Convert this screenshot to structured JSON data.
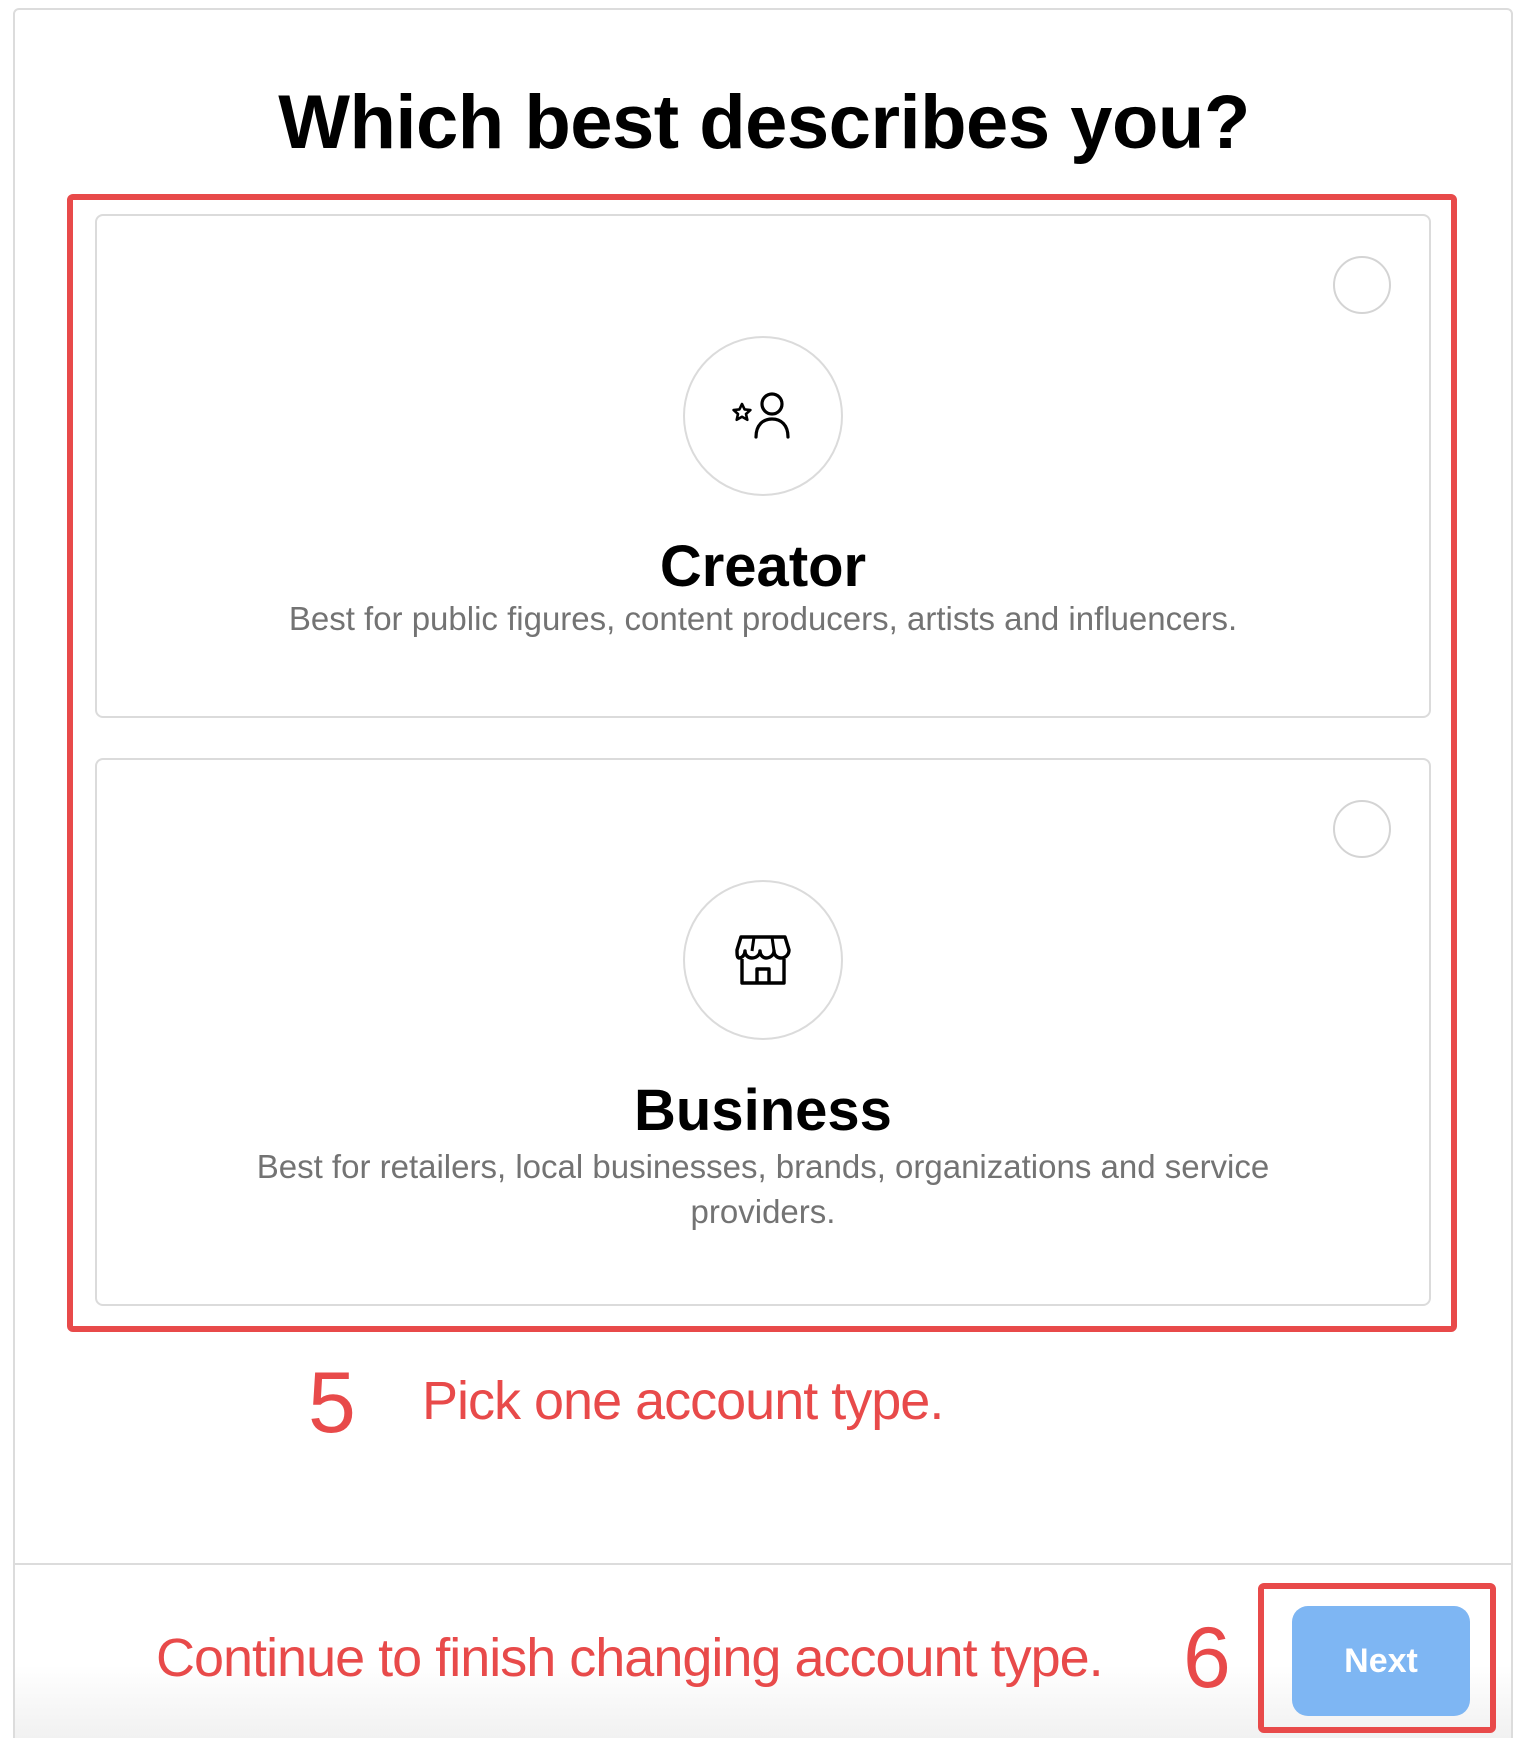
{
  "title": "Which best describes you?",
  "options": [
    {
      "label": "Creator",
      "description": "Best for public figures, content producers, artists and influencers.",
      "icon": "creator-star-person-icon",
      "selected": false
    },
    {
      "label": "Business",
      "description": "Best for retailers, local businesses, brands, organizations and service providers.",
      "icon": "storefront-icon",
      "selected": false
    }
  ],
  "annotations": {
    "step5_number": "5",
    "step5_text": "Pick one account type.",
    "step6_number": "6",
    "step6_text": "Continue to finish changing account type."
  },
  "footer": {
    "next_label": "Next"
  },
  "colors": {
    "annotation_red": "#e84a4a",
    "next_button_disabled": "#7eb6f3",
    "description_gray": "#737373"
  }
}
